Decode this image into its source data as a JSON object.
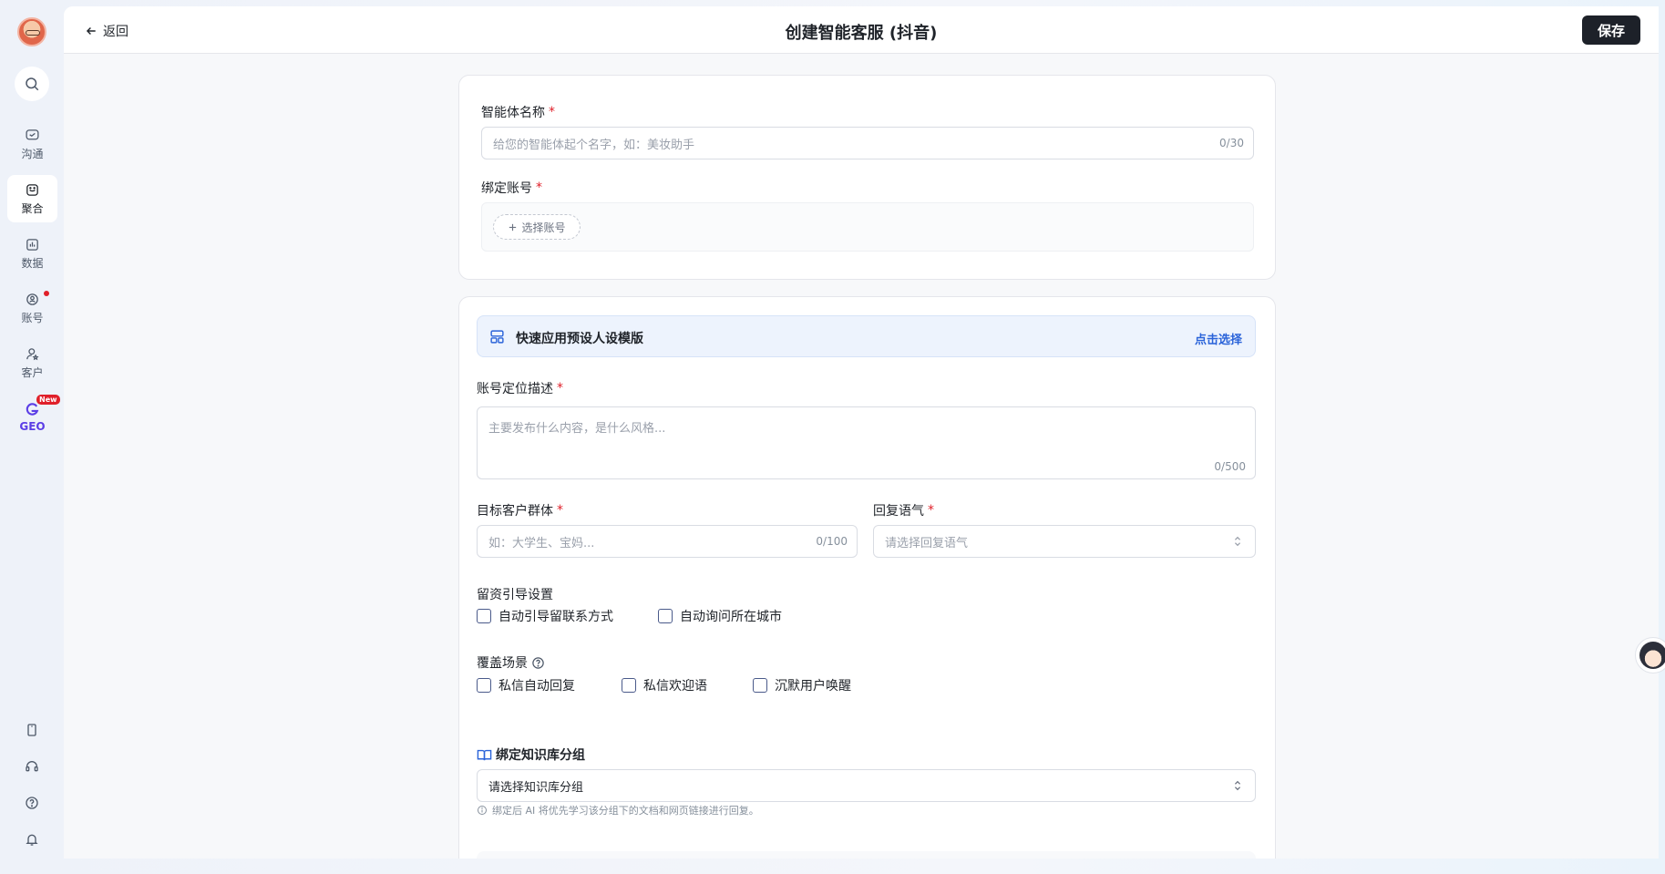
{
  "colors": {
    "accent": "#2a63d9",
    "required": "#e0202a",
    "geo": "#5b3ee6",
    "save_button_bg": "#1d2129"
  },
  "sidebar": {
    "items": [
      {
        "label": "沟通",
        "icon": "chat-icon"
      },
      {
        "label": "聚合",
        "icon": "aggregate-icon",
        "active": true
      },
      {
        "label": "数据",
        "icon": "chart-icon"
      },
      {
        "label": "账号",
        "icon": "account-icon",
        "has_dot": true
      },
      {
        "label": "客户",
        "icon": "customer-icon"
      }
    ],
    "geo": {
      "label": "GEO",
      "badge": "New"
    },
    "bottom_icons": [
      "phone-icon",
      "headset-icon",
      "help-icon",
      "bell-icon"
    ]
  },
  "header": {
    "back_label": "返回",
    "title": "创建智能客服 (抖音)",
    "save_label": "保存"
  },
  "form": {
    "agent_name": {
      "label": "智能体名称",
      "placeholder": "给您的智能体起个名字，如：美妆助手",
      "counter": "0/30"
    },
    "bind_account": {
      "label": "绑定账号",
      "button": "选择账号"
    },
    "template": {
      "title": "快速应用预设人设模版",
      "link": "点击选择"
    },
    "positioning": {
      "label": "账号定位描述",
      "placeholder": "主要发布什么内容，是什么风格...",
      "counter": "0/500"
    },
    "target_group": {
      "label": "目标客户群体",
      "placeholder": "如：大学生、宝妈...",
      "counter": "0/100"
    },
    "tone": {
      "label": "回复语气",
      "placeholder": "请选择回复语气"
    },
    "lead": {
      "label": "留资引导设置",
      "options": [
        "自动引导留联系方式",
        "自动询问所在城市"
      ]
    },
    "scenes": {
      "label": "覆盖场景",
      "options": [
        "私信自动回复",
        "私信欢迎语",
        "沉默用户唤醒"
      ]
    },
    "knowledge": {
      "label": "绑定知识库分组",
      "placeholder": "请选择知识库分组",
      "hint": "绑定后 AI 将优先学习该分组下的文档和网页链接进行回复。"
    }
  }
}
